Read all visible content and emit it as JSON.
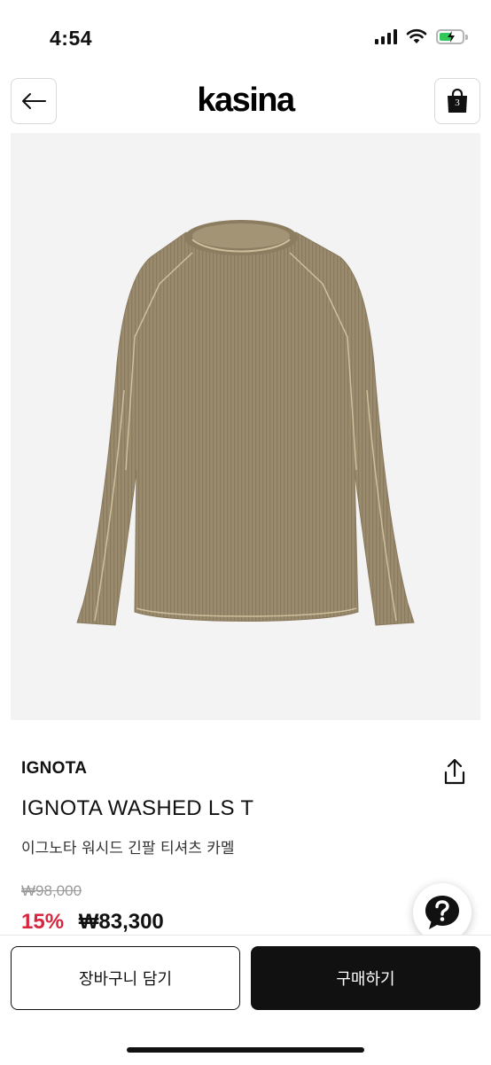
{
  "status_bar": {
    "time": "4:54"
  },
  "header": {
    "logo": "kasina",
    "cart_count": "3"
  },
  "product": {
    "brand": "IGNOTA",
    "name": "IGNOTA WASHED LS T",
    "name_ko": "이그노타 워시드 긴팔 티셔츠 카멜",
    "original_price": "₩98,000",
    "discount": "15%",
    "sale_price": "₩83,300",
    "image_color": "#9a8a6e"
  },
  "actions": {
    "add_to_cart": "장바구니 담기",
    "buy_now": "구매하기"
  },
  "icons": {
    "back": "arrow-left-icon",
    "cart": "shopping-bag-icon",
    "share": "share-icon",
    "help": "question-mark-icon"
  },
  "colors": {
    "discount": "#d7263d",
    "primary_button": "#111111",
    "battery": "#34c759"
  }
}
